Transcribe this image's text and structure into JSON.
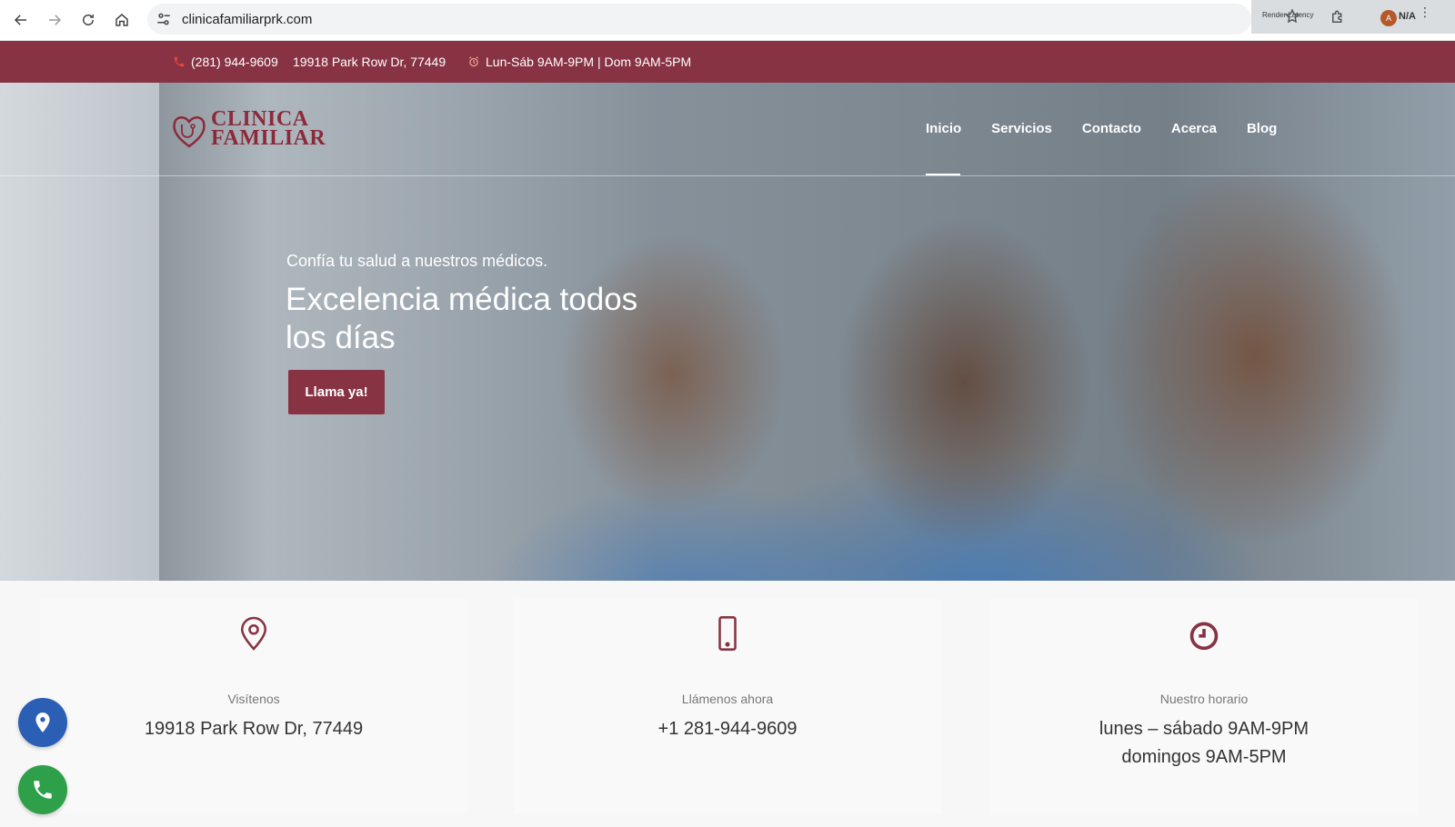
{
  "browser": {
    "url": "clinicafamiliarprk.com",
    "extension_label": "Render Latency",
    "avatar_letter": "A",
    "profile_text": "N/A"
  },
  "topbar": {
    "phone": "(281) 944-9609",
    "address": "19918 Park Row Dr, 77449",
    "hours": "Lun-Sáb 9AM-9PM | Dom 9AM-5PM"
  },
  "header": {
    "logo_line1": "CLINICA",
    "logo_line2": "FAMILIAR",
    "nav": [
      {
        "label": "Inicio",
        "active": true
      },
      {
        "label": "Servicios",
        "active": false
      },
      {
        "label": "Contacto",
        "active": false
      },
      {
        "label": "Acerca",
        "active": false
      },
      {
        "label": "Blog",
        "active": false
      }
    ]
  },
  "hero": {
    "subtitle": "Confía tu salud a nuestros médicos.",
    "title": "Excelencia médica todos los días",
    "cta": "Llama ya!"
  },
  "info": [
    {
      "icon": "location-pin-icon",
      "label": "Visítenos",
      "value": "19918 Park Row Dr, 77449"
    },
    {
      "icon": "mobile-phone-icon",
      "label": "Llámenos ahora",
      "value": "+1 281-944-9609"
    },
    {
      "icon": "clock-icon",
      "label": "Nuestro horario",
      "value_line1": "lunes – sábado 9AM-9PM",
      "value_line2": "domingos 9AM-5PM"
    }
  ],
  "colors": {
    "brand": "#883343",
    "location_button": "#2b5fb5",
    "call_button": "#2ea04a"
  }
}
